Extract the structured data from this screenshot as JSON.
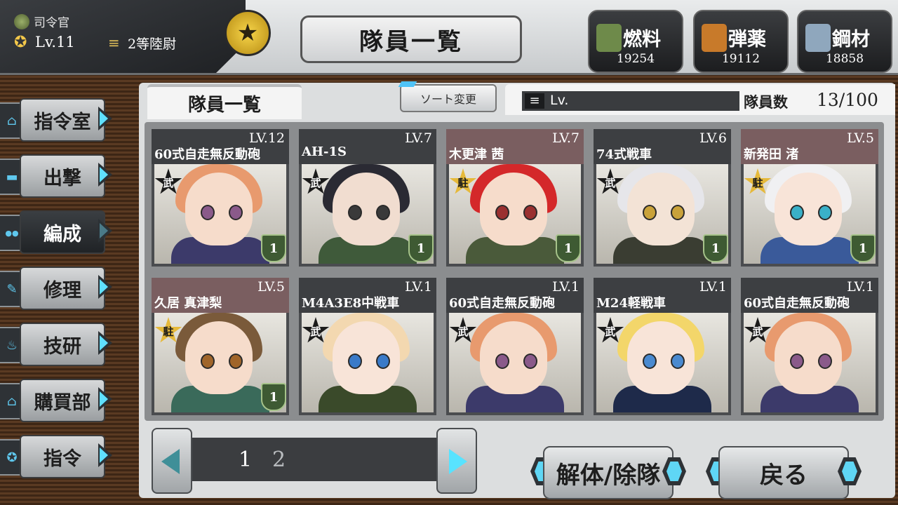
{
  "commander": {
    "title": "司令官",
    "level": "Lv.11",
    "rank": "2等陸尉"
  },
  "screen_title": "隊員一覧",
  "resources": [
    {
      "name": "燃料",
      "value": "19254",
      "icon": "fuel-can-icon",
      "color": "#6e8a4a"
    },
    {
      "name": "弾薬",
      "value": "19112",
      "icon": "ammo-crate-icon",
      "color": "#c87a2a"
    },
    {
      "name": "鋼材",
      "value": "18858",
      "icon": "steel-icon",
      "color": "#8fa7bd"
    }
  ],
  "side_menu": [
    {
      "label": "指令室",
      "icon": "home-icon",
      "glyph": "⌂",
      "active": false
    },
    {
      "label": "出撃",
      "icon": "tank-icon",
      "glyph": "▬",
      "active": false
    },
    {
      "label": "編成",
      "icon": "people-icon",
      "glyph": "●●",
      "active": true
    },
    {
      "label": "修理",
      "icon": "wrench-icon",
      "glyph": "✎",
      "active": false
    },
    {
      "label": "技研",
      "icon": "flame-icon",
      "glyph": "♨",
      "active": false
    },
    {
      "label": "購買部",
      "icon": "basket-icon",
      "glyph": "⌂",
      "active": false
    },
    {
      "label": "指令",
      "icon": "medal-icon",
      "glyph": "✪",
      "active": false
    }
  ],
  "panel": {
    "tab_label": "隊員一覧",
    "sort_label": "ソート変更",
    "filter_value": "Lv.",
    "count_label": "隊員数",
    "count_value": "13/100"
  },
  "members": [
    {
      "level": "LV.12",
      "name": "60式自走無反動砲",
      "badge": "武",
      "badge_style": "dark",
      "rank": "1",
      "hair": "#e89a6e",
      "skin": "#f6dccb",
      "outfit": "#3c3a6a",
      "eyes": "#8a5a8a",
      "header_tint": "dark"
    },
    {
      "level": "LV.7",
      "name": "AH-1S",
      "badge": "武",
      "badge_style": "dark",
      "rank": "1",
      "hair": "#2a2a33",
      "skin": "#f1ddd0",
      "outfit": "#3f5a3a",
      "eyes": "#3a3a3a",
      "header_tint": "dark"
    },
    {
      "level": "LV.7",
      "name": "木更津 茜",
      "badge": "駐",
      "badge_style": "gold",
      "rank": "1",
      "hair": "#d4282a",
      "skin": "#f6dccb",
      "outfit": "#4a5a3a",
      "eyes": "#9a3030",
      "header_tint": "pink"
    },
    {
      "level": "LV.6",
      "name": "74式戦車",
      "badge": "武",
      "badge_style": "dark",
      "rank": "1",
      "hair": "#e6e6ea",
      "skin": "#f3e3d6",
      "outfit": "#3a3d32",
      "eyes": "#c9a23a",
      "header_tint": "dark"
    },
    {
      "level": "LV.5",
      "name": "新発田 渚",
      "badge": "駐",
      "badge_style": "gold",
      "rank": "1",
      "hair": "#f0f0f2",
      "skin": "#f8e4d8",
      "outfit": "#3a5a9a",
      "eyes": "#3ab0c8",
      "header_tint": "pink"
    },
    {
      "level": "LV.5",
      "name": "久居 真津梨",
      "badge": "駐",
      "badge_style": "gold",
      "rank": "1",
      "hair": "#7a5a3a",
      "skin": "#f6dccb",
      "outfit": "#3a6a5a",
      "eyes": "#a0652a",
      "header_tint": "pink"
    },
    {
      "level": "LV.1",
      "name": "M4A3E8中戦車",
      "badge": "武",
      "badge_style": "dark",
      "rank": "",
      "hair": "#f3d8b0",
      "skin": "#f8e4d8",
      "outfit": "#3a4a2a",
      "eyes": "#3a7ac8",
      "header_tint": "dark"
    },
    {
      "level": "LV.1",
      "name": "60式自走無反動砲",
      "badge": "武",
      "badge_style": "dark",
      "rank": "",
      "hair": "#e89a6e",
      "skin": "#f6dccb",
      "outfit": "#3c3a6a",
      "eyes": "#8a5a8a",
      "header_tint": "dark"
    },
    {
      "level": "LV.1",
      "name": "M24軽戦車",
      "badge": "武",
      "badge_style": "dark",
      "rank": "",
      "hair": "#f3d66a",
      "skin": "#f8e4d8",
      "outfit": "#1e2a4a",
      "eyes": "#4a8ad0",
      "header_tint": "dark"
    },
    {
      "level": "LV.1",
      "name": "60式自走無反動砲",
      "badge": "武",
      "badge_style": "dark",
      "rank": "",
      "hair": "#e89a6e",
      "skin": "#f6dccb",
      "outfit": "#3c3a6a",
      "eyes": "#8a5a8a",
      "header_tint": "dark"
    }
  ],
  "pager": {
    "pages": [
      "1",
      "2"
    ],
    "current": "1"
  },
  "actions": {
    "disband_label": "解体/除隊",
    "back_label": "戻る"
  }
}
